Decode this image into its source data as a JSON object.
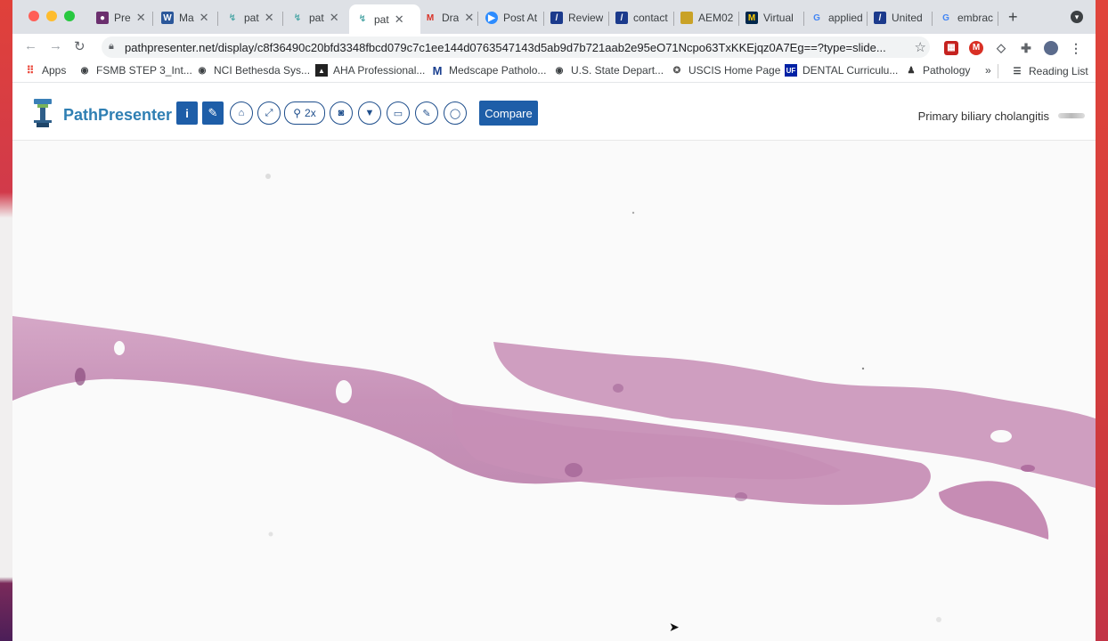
{
  "browser": {
    "tabs": [
      {
        "title": "Pre",
        "active": false
      },
      {
        "title": "Ma",
        "active": false
      },
      {
        "title": "pat",
        "active": false
      },
      {
        "title": "pat",
        "active": false
      },
      {
        "title": "pat",
        "active": true
      },
      {
        "title": "Dra",
        "active": false
      },
      {
        "title": "Post At",
        "active": false
      },
      {
        "title": "Review",
        "active": false
      },
      {
        "title": "contact",
        "active": false
      },
      {
        "title": "AEM02",
        "active": false
      },
      {
        "title": "Virtual",
        "active": false
      },
      {
        "title": "applied",
        "active": false
      },
      {
        "title": "United",
        "active": false
      },
      {
        "title": "embrac",
        "active": false
      }
    ],
    "url": "pathpresenter.net/display/c8f36490c20bfd3348fbcd079c7c1ee144d0763547143d5ab9d7b721aab2e95eO71Ncpo63TxKKEjqz0A7Eg==?type=slide...",
    "bookmarks": [
      "Apps",
      "FSMB STEP 3_Int...",
      "NCI Bethesda Sys...",
      "AHA Professional...",
      "Medscape Patholo...",
      "U.S. State Depart...",
      "USCIS Home Page",
      "DENTAL Curriculu...",
      "Pathology"
    ],
    "bookmarks_overflow": "»",
    "reading_list": "Reading List"
  },
  "app": {
    "brand": "PathPresenter",
    "zoom_label": "2x",
    "compare_label": "Compare",
    "diagnosis": "Primary biliary cholangitis"
  },
  "colors": {
    "accent": "#1e5ea8",
    "brand_text": "#2f7fb3",
    "tissue": "#c98fb5"
  }
}
